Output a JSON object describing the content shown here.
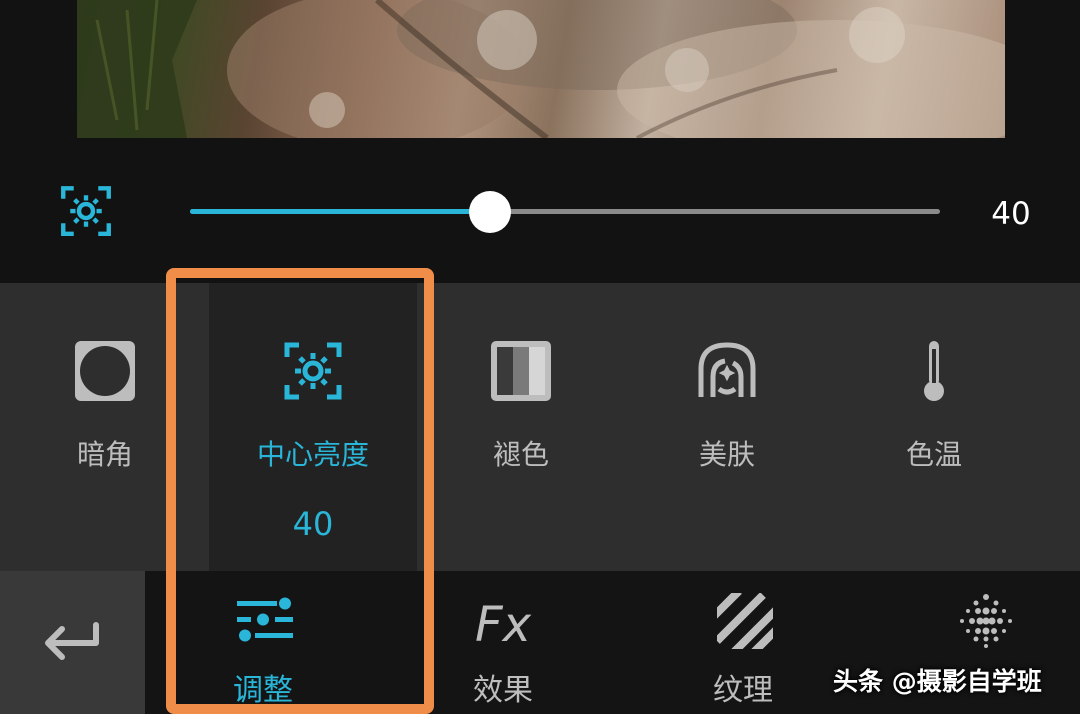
{
  "slider": {
    "icon": "center-brightness-icon",
    "value": 40,
    "value_label": "40",
    "fill_fraction": 0.4,
    "accent_color": "#29b6d8"
  },
  "tools": {
    "items": [
      {
        "label": "暗角",
        "icon": "vignette-icon",
        "active": false
      },
      {
        "label": "中心亮度",
        "icon": "center-brightness-icon",
        "active": true,
        "value": "40"
      },
      {
        "label": "褪色",
        "icon": "fade-icon",
        "active": false
      },
      {
        "label": "美肤",
        "icon": "skin-smoothing-icon",
        "active": false
      },
      {
        "label": "色温",
        "icon": "thermometer-icon",
        "active": false
      }
    ]
  },
  "nav": {
    "back_icon": "back-arrow-icon",
    "items": [
      {
        "label": "调整",
        "icon": "sliders-icon",
        "active": true
      },
      {
        "label": "效果",
        "icon": "fx-icon",
        "active": false
      },
      {
        "label": "纹理",
        "icon": "stripes-icon",
        "active": false
      },
      {
        "label": "",
        "icon": "dot-grid-icon",
        "active": false
      }
    ]
  },
  "highlight_color": "#f08d48",
  "watermark": "头条 @摄影自学班"
}
